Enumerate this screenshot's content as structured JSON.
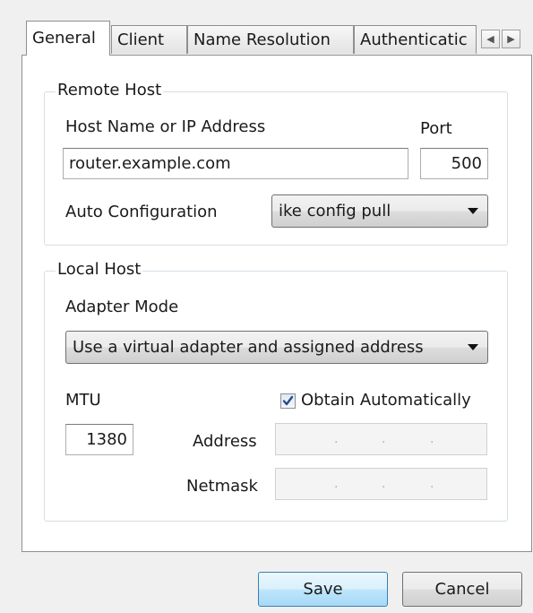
{
  "tabs": [
    {
      "label": "General",
      "active": true
    },
    {
      "label": "Client",
      "active": false
    },
    {
      "label": "Name Resolution",
      "active": false
    },
    {
      "label": "Authenticatic",
      "active": false
    }
  ],
  "tab_scroll": {
    "left_icon": "arrow-left-icon",
    "right_icon": "arrow-right-icon"
  },
  "remote_host": {
    "legend": "Remote Host",
    "host_label": "Host Name or IP Address",
    "host_value": "router.example.com",
    "port_label": "Port",
    "port_value": "500",
    "auto_config_label": "Auto Configuration",
    "auto_config_value": "ike config pull"
  },
  "local_host": {
    "legend": "Local Host",
    "adapter_mode_label": "Adapter Mode",
    "adapter_mode_value": "Use a virtual adapter and assigned address",
    "mtu_label": "MTU",
    "mtu_value": "1380",
    "obtain_auto_label": "Obtain Automatically",
    "obtain_auto_checked": true,
    "address_label": "Address",
    "netmask_label": "Netmask",
    "ip_separator": "."
  },
  "buttons": {
    "save": "Save",
    "cancel": "Cancel"
  },
  "colors": {
    "checkmark": "#2b4a8b",
    "default_button_border": "#3c7fb1"
  }
}
